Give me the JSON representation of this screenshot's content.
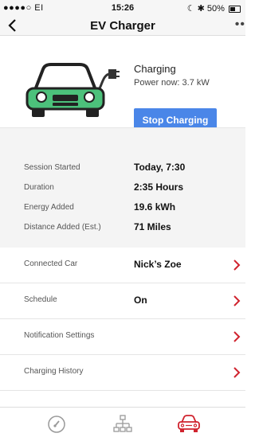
{
  "status_bar": {
    "carrier": "●●●●○ EI",
    "time": "15:26",
    "battery_text": "50%",
    "battery_level": 0.5
  },
  "nav": {
    "title": "EV Charger",
    "more": "••"
  },
  "hero": {
    "status_title": "Charging",
    "status_sub": "Power now: 3.7 kW",
    "stop_button": "Stop Charging"
  },
  "stats": [
    {
      "label": "Session Started",
      "value": "Today, 7:30"
    },
    {
      "label": "Duration",
      "value": "2:35 Hours"
    },
    {
      "label": "Energy Added",
      "value": "19.6 kWh"
    },
    {
      "label": "Distance Added  (Est.)",
      "value": "71 Miles"
    }
  ],
  "rows": [
    {
      "label": "Connected Car",
      "value": "Nick’s Zoe"
    },
    {
      "label": "Schedule",
      "value": "On"
    },
    {
      "label": "Notification Settings",
      "value": ""
    },
    {
      "label": "Charging History",
      "value": ""
    }
  ],
  "tabs": [
    {
      "icon": "gauge-icon",
      "active": false
    },
    {
      "icon": "network-icon",
      "active": false
    },
    {
      "icon": "car-icon",
      "active": true
    }
  ],
  "colors": {
    "accent_blue": "#4a86e8",
    "car_green": "#4cc17b",
    "chevron_red": "#d0232e",
    "active_tab": "#d0232e"
  }
}
